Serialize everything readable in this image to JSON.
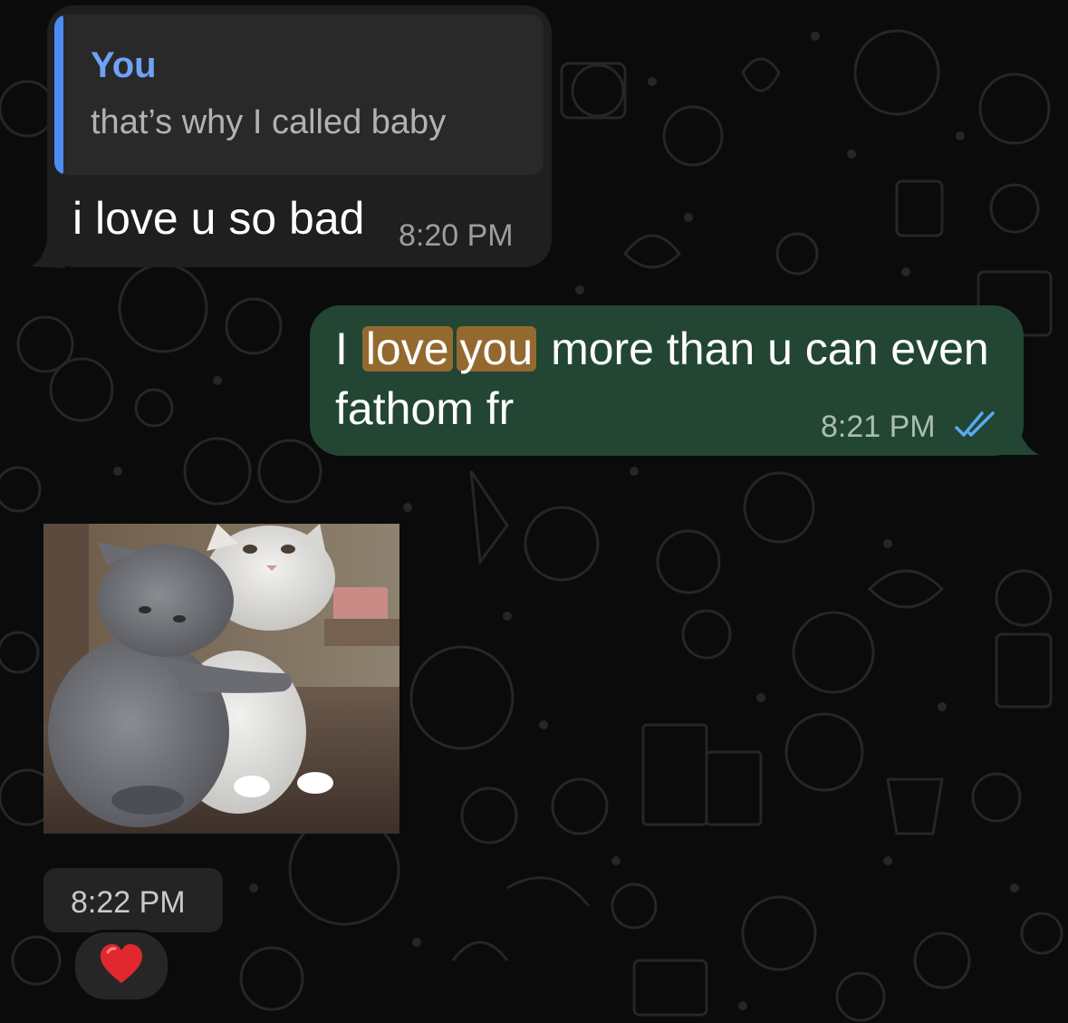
{
  "chat": {
    "incoming_message": {
      "reply_quote": {
        "author": "You",
        "text": "that’s why I called baby"
      },
      "text": "i love u so bad",
      "time": "8:20 PM"
    },
    "outgoing_message": {
      "line1_word1": "I",
      "line1_highlight1": "love",
      "line1_highlight2": "you",
      "line1_rest": "more than u can even",
      "line2": "fathom fr",
      "time": "8:21 PM",
      "status_icon": "double-check-read-icon"
    },
    "incoming_image": {
      "content": "animated-gif-two-cats-hugging",
      "time": "8:22 PM",
      "reaction_icon": "red-heart-emoji"
    }
  },
  "colors": {
    "background": "#0b0b0b",
    "incoming_bubble": "#1f1f1f",
    "outgoing_bubble": "#224633",
    "quote_accent": "#4e8cf5",
    "search_highlight": "#94692f",
    "read_ticks": "#5aa8f0"
  }
}
